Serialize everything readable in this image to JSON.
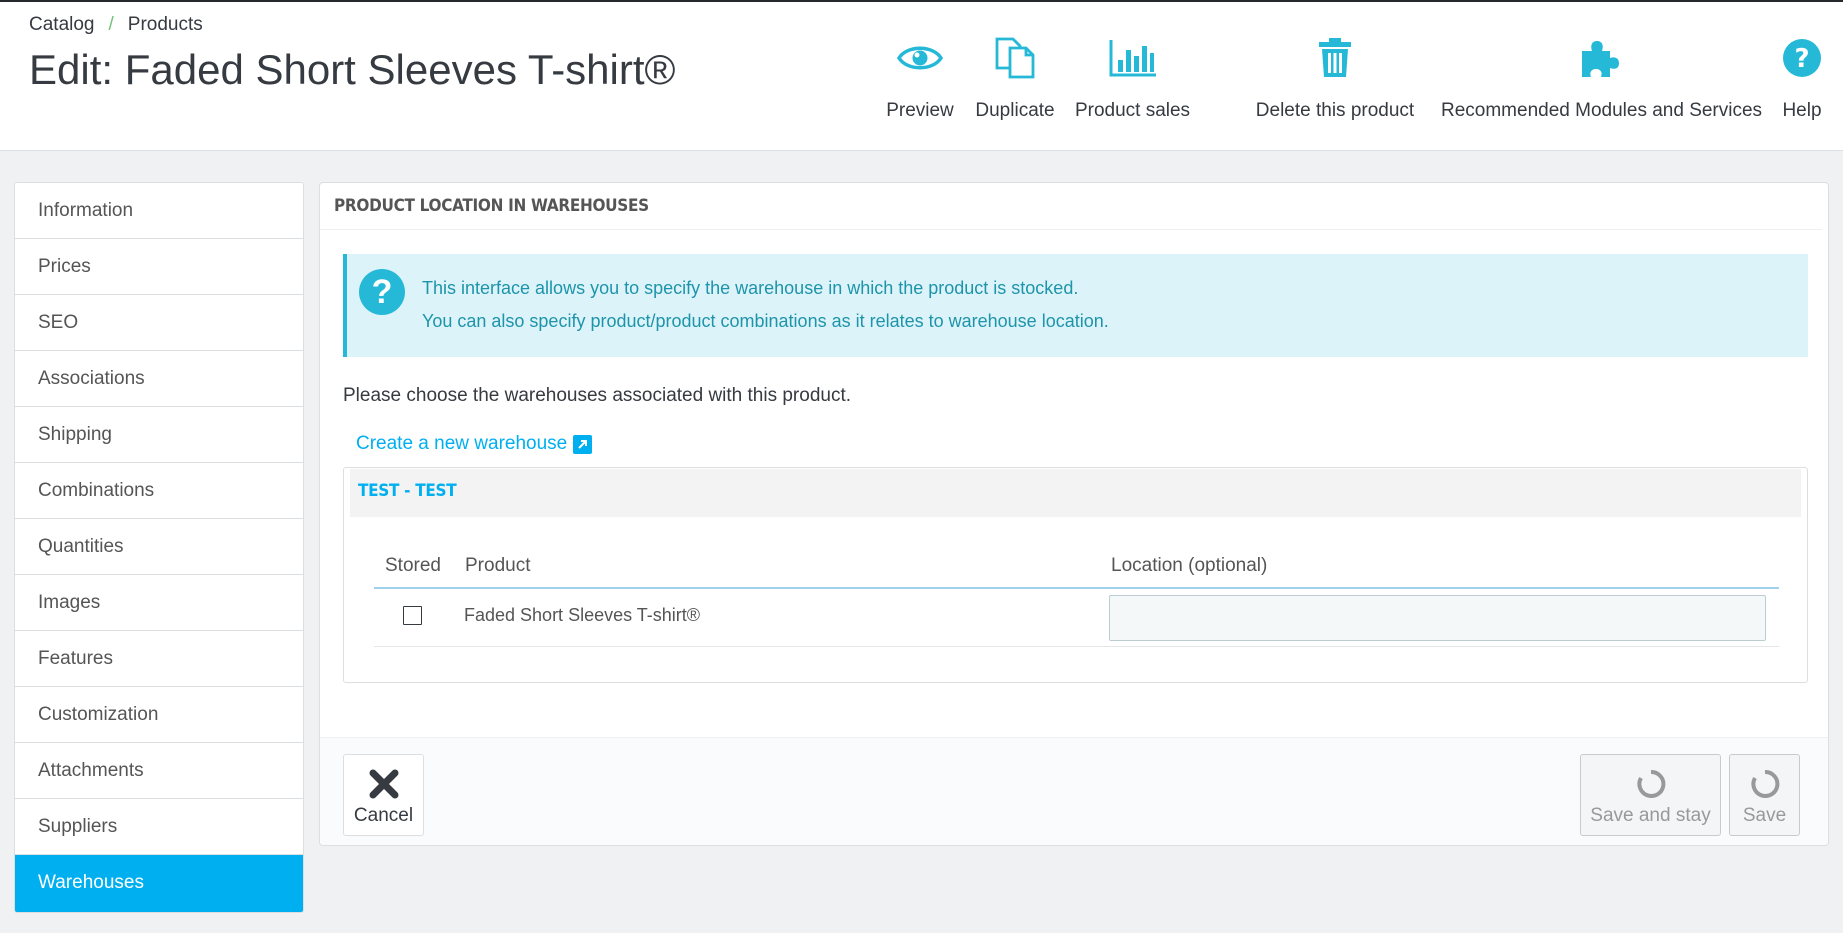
{
  "breadcrumb": {
    "items": [
      "Catalog",
      "Products"
    ],
    "separator": "/"
  },
  "page": {
    "title": "Edit: Faded Short Sleeves T-shirt®"
  },
  "toolbar": {
    "preview": "Preview",
    "duplicate": "Duplicate",
    "product_sales": "Product sales",
    "delete": "Delete this product",
    "recommended": "Recommended Modules and Services",
    "help": "Help"
  },
  "sidebar": {
    "items": [
      {
        "label": "Information"
      },
      {
        "label": "Prices"
      },
      {
        "label": "SEO"
      },
      {
        "label": "Associations"
      },
      {
        "label": "Shipping"
      },
      {
        "label": "Combinations"
      },
      {
        "label": "Quantities"
      },
      {
        "label": "Images"
      },
      {
        "label": "Features"
      },
      {
        "label": "Customization"
      },
      {
        "label": "Attachments"
      },
      {
        "label": "Suppliers"
      },
      {
        "label": "Warehouses",
        "active": true
      }
    ]
  },
  "panel": {
    "heading": "PRODUCT LOCATION IN WAREHOUSES",
    "alert": {
      "line1": "This interface allows you to specify the warehouse in which the product is stocked.",
      "line2": "You can also specify product/product combinations as it relates to warehouse location."
    },
    "choose_text": "Please choose the warehouses associated with this product.",
    "create_link": "Create a new warehouse",
    "warehouse": {
      "title": "TEST - TEST",
      "columns": {
        "stored": "Stored",
        "product": "Product",
        "location": "Location (optional)"
      },
      "rows": [
        {
          "product": "Faded Short Sleeves T-shirt®",
          "stored": false,
          "location": ""
        }
      ]
    }
  },
  "footer": {
    "cancel": "Cancel",
    "save_and_stay": "Save and stay",
    "save": "Save"
  },
  "colors": {
    "accent": "#00aff0",
    "icon": "#25b9d7",
    "alert_bg": "#dcf4f9"
  }
}
